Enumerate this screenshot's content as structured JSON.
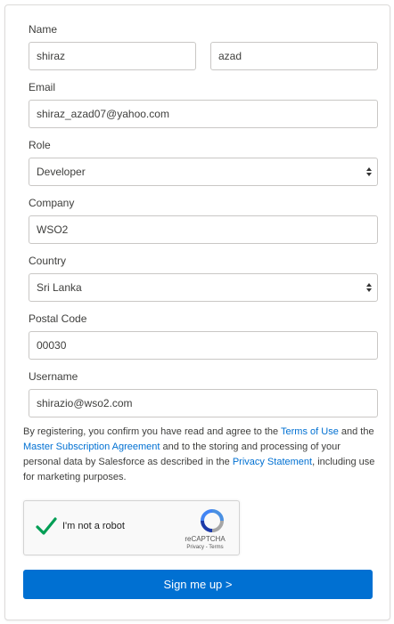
{
  "form": {
    "name": {
      "label": "Name",
      "first": "shiraz",
      "last": "azad"
    },
    "email": {
      "label": "Email",
      "value": "shiraz_azad07@yahoo.com"
    },
    "role": {
      "label": "Role",
      "value": "Developer"
    },
    "company": {
      "label": "Company",
      "value": "WSO2"
    },
    "country": {
      "label": "Country",
      "value": "Sri Lanka"
    },
    "postal": {
      "label": "Postal Code",
      "value": "00030"
    },
    "username": {
      "label": "Username",
      "value": "shirazio@wso2.com"
    }
  },
  "consent": {
    "t1": "By registering, you confirm you have read and agree to the ",
    "terms_link": "Terms of Use",
    "t2": " and the ",
    "msa_link": "Master Subscription Agreement",
    "t3": " and to the storing and processing of your personal data by Salesforce as described in the ",
    "privacy_link": "Privacy Statement",
    "t4": ", including use for marketing purposes."
  },
  "captcha": {
    "label": "I'm not a robot",
    "brand": "reCAPTCHA",
    "links": "Privacy - Terms"
  },
  "signup_label": "Sign me up >",
  "colors": {
    "accent": "#0070d2",
    "border": "#c9c7c5",
    "check": "#009e55"
  }
}
